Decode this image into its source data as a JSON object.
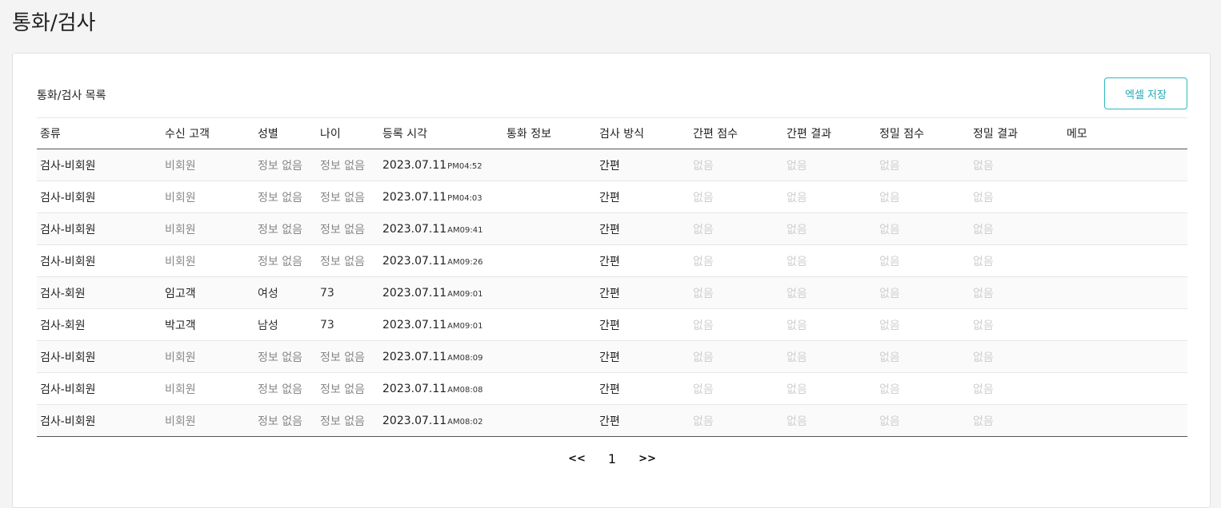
{
  "page": {
    "title": "통화/검사"
  },
  "card": {
    "list_title": "통화/검사 목록",
    "excel_button": "엑셀 저장"
  },
  "table": {
    "columns": [
      "종류",
      "수신 고객",
      "성별",
      "나이",
      "등록 시각",
      "통화 정보",
      "검사 방식",
      "간편 점수",
      "간편 결과",
      "정밀 점수",
      "정밀 결과",
      "메모"
    ],
    "rows": [
      {
        "type": "검사-비회원",
        "customer": "비회원",
        "gender": "정보 없음",
        "age": "정보 없음",
        "date": "2023.07.11",
        "ampm": "PM04:52",
        "call_info": "",
        "method": "간편",
        "simple_score": "없음",
        "simple_result": "없음",
        "detail_score": "없음",
        "detail_result": "없음",
        "memo": "",
        "member": false
      },
      {
        "type": "검사-비회원",
        "customer": "비회원",
        "gender": "정보 없음",
        "age": "정보 없음",
        "date": "2023.07.11",
        "ampm": "PM04:03",
        "call_info": "",
        "method": "간편",
        "simple_score": "없음",
        "simple_result": "없음",
        "detail_score": "없음",
        "detail_result": "없음",
        "memo": "",
        "member": false
      },
      {
        "type": "검사-비회원",
        "customer": "비회원",
        "gender": "정보 없음",
        "age": "정보 없음",
        "date": "2023.07.11",
        "ampm": "AM09:41",
        "call_info": "",
        "method": "간편",
        "simple_score": "없음",
        "simple_result": "없음",
        "detail_score": "없음",
        "detail_result": "없음",
        "memo": "",
        "member": false
      },
      {
        "type": "검사-비회원",
        "customer": "비회원",
        "gender": "정보 없음",
        "age": "정보 없음",
        "date": "2023.07.11",
        "ampm": "AM09:26",
        "call_info": "",
        "method": "간편",
        "simple_score": "없음",
        "simple_result": "없음",
        "detail_score": "없음",
        "detail_result": "없음",
        "memo": "",
        "member": false
      },
      {
        "type": "검사-회원",
        "customer": "임고객",
        "gender": "여성",
        "age": "73",
        "date": "2023.07.11",
        "ampm": "AM09:01",
        "call_info": "",
        "method": "간편",
        "simple_score": "없음",
        "simple_result": "없음",
        "detail_score": "없음",
        "detail_result": "없음",
        "memo": "",
        "member": true
      },
      {
        "type": "검사-회원",
        "customer": "박고객",
        "gender": "남성",
        "age": "73",
        "date": "2023.07.11",
        "ampm": "AM09:01",
        "call_info": "",
        "method": "간편",
        "simple_score": "없음",
        "simple_result": "없음",
        "detail_score": "없음",
        "detail_result": "없음",
        "memo": "",
        "member": true
      },
      {
        "type": "검사-비회원",
        "customer": "비회원",
        "gender": "정보 없음",
        "age": "정보 없음",
        "date": "2023.07.11",
        "ampm": "AM08:09",
        "call_info": "",
        "method": "간편",
        "simple_score": "없음",
        "simple_result": "없음",
        "detail_score": "없음",
        "detail_result": "없음",
        "memo": "",
        "member": false
      },
      {
        "type": "검사-비회원",
        "customer": "비회원",
        "gender": "정보 없음",
        "age": "정보 없음",
        "date": "2023.07.11",
        "ampm": "AM08:08",
        "call_info": "",
        "method": "간편",
        "simple_score": "없음",
        "simple_result": "없음",
        "detail_score": "없음",
        "detail_result": "없음",
        "memo": "",
        "member": false
      },
      {
        "type": "검사-비회원",
        "customer": "비회원",
        "gender": "정보 없음",
        "age": "정보 없음",
        "date": "2023.07.11",
        "ampm": "AM08:02",
        "call_info": "",
        "method": "간편",
        "simple_score": "없음",
        "simple_result": "없음",
        "detail_score": "없음",
        "detail_result": "없음",
        "memo": "",
        "member": false
      }
    ]
  },
  "pagination": {
    "first": "<<",
    "current": "1",
    "last": ">>"
  }
}
